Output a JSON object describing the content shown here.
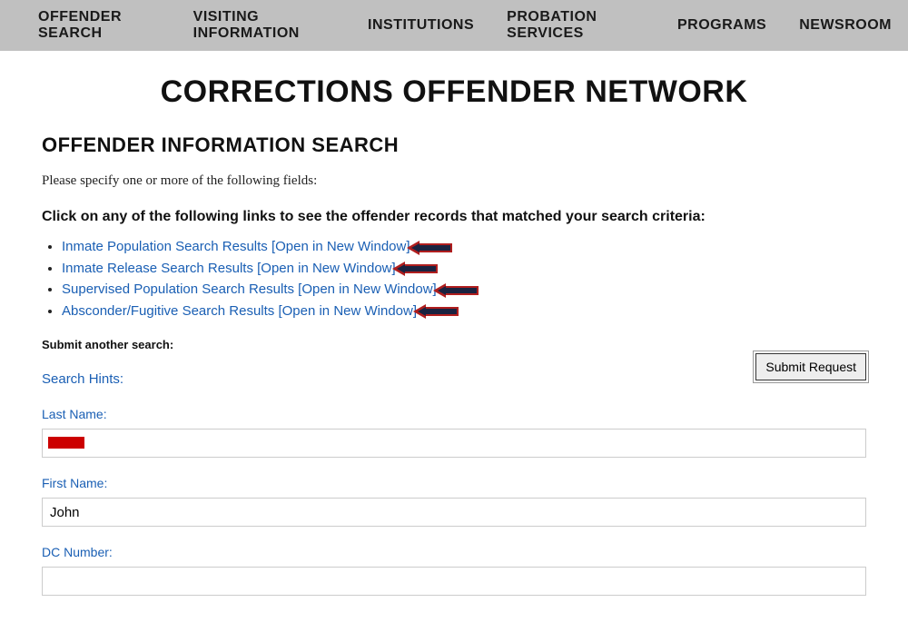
{
  "nav": {
    "items": [
      "OFFENDER SEARCH",
      "VISITING INFORMATION",
      "INSTITUTIONS",
      "PROBATION SERVICES",
      "PROGRAMS",
      "NEWSROOM"
    ]
  },
  "page": {
    "title": "CORRECTIONS OFFENDER NETWORK",
    "section_title": "OFFENDER INFORMATION SEARCH",
    "instruction": "Please specify one or more of the following fields:",
    "results_header": "Click on any of the following links to see the offender records that matched your search criteria:",
    "submit_another": "Submit another search:",
    "search_hints": "Search Hints:",
    "submit_button": "Submit Request"
  },
  "result_links": [
    "Inmate Population Search Results [Open in New Window]",
    "Inmate Release Search Results [Open in New Window]",
    "Supervised Population Search Results [Open in New Window]",
    "Absconder/Fugitive Search Results [Open in New Window]"
  ],
  "form": {
    "last_name": {
      "label": "Last Name:",
      "value": ""
    },
    "first_name": {
      "label": "First Name:",
      "value": "John"
    },
    "dc_number": {
      "label": "DC Number:",
      "value": ""
    }
  }
}
